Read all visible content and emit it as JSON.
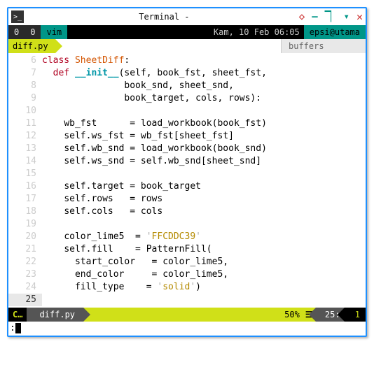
{
  "window": {
    "title": "Terminal -"
  },
  "top_status": {
    "left0": "0",
    "left1": "0",
    "app": "vim",
    "date": "Kam, 10 Feb 06:05",
    "user": "epsi@utama"
  },
  "tabs": {
    "active": "diff.py",
    "right": "buffers"
  },
  "code": {
    "lines": [
      {
        "n": 6,
        "indent": "",
        "tokens": [
          {
            "t": "class ",
            "c": "kw"
          },
          {
            "t": "SheetDiff",
            "c": "cls"
          },
          {
            "t": ":",
            "c": ""
          }
        ]
      },
      {
        "n": 7,
        "indent": "  ",
        "tokens": [
          {
            "t": "def ",
            "c": "kw"
          },
          {
            "t": "__init__",
            "c": "def"
          },
          {
            "t": "(self, book_fst, sheet_fst,",
            "c": ""
          }
        ]
      },
      {
        "n": 8,
        "indent": "               ",
        "tokens": [
          {
            "t": "book_snd, sheet_snd,",
            "c": ""
          }
        ]
      },
      {
        "n": 9,
        "indent": "               ",
        "tokens": [
          {
            "t": "book_target, cols, rows):",
            "c": ""
          }
        ]
      },
      {
        "n": 10,
        "indent": "",
        "tokens": []
      },
      {
        "n": 11,
        "indent": "    ",
        "tokens": [
          {
            "t": "wb_fst      = load_workbook(book_fst)",
            "c": ""
          }
        ]
      },
      {
        "n": 12,
        "indent": "    ",
        "tokens": [
          {
            "t": "self.ws_fst = wb_fst[sheet_fst]",
            "c": ""
          }
        ]
      },
      {
        "n": 13,
        "indent": "    ",
        "tokens": [
          {
            "t": "self.wb_snd = load_workbook(book_snd)",
            "c": ""
          }
        ]
      },
      {
        "n": 14,
        "indent": "    ",
        "tokens": [
          {
            "t": "self.ws_snd = self.wb_snd[sheet_snd]",
            "c": ""
          }
        ]
      },
      {
        "n": 15,
        "indent": "",
        "tokens": []
      },
      {
        "n": 16,
        "indent": "    ",
        "tokens": [
          {
            "t": "self.target = book_target",
            "c": ""
          }
        ]
      },
      {
        "n": 17,
        "indent": "    ",
        "tokens": [
          {
            "t": "self.rows   = rows",
            "c": ""
          }
        ]
      },
      {
        "n": 18,
        "indent": "    ",
        "tokens": [
          {
            "t": "self.cols   = cols",
            "c": ""
          }
        ]
      },
      {
        "n": 19,
        "indent": "",
        "tokens": []
      },
      {
        "n": 20,
        "indent": "    ",
        "tokens": [
          {
            "t": "color_lime5  = ",
            "c": ""
          },
          {
            "t": "'",
            "c": "sep"
          },
          {
            "t": "FFCDDC39",
            "c": "str"
          },
          {
            "t": "'",
            "c": "sep"
          }
        ]
      },
      {
        "n": 21,
        "indent": "    ",
        "tokens": [
          {
            "t": "self.fill    = PatternFill(",
            "c": ""
          }
        ]
      },
      {
        "n": 22,
        "indent": "      ",
        "tokens": [
          {
            "t": "start_color   = color_lime5,",
            "c": ""
          }
        ]
      },
      {
        "n": 23,
        "indent": "      ",
        "tokens": [
          {
            "t": "end_color     = color_lime5,",
            "c": ""
          }
        ]
      },
      {
        "n": 24,
        "indent": "      ",
        "tokens": [
          {
            "t": "fill_type    = ",
            "c": ""
          },
          {
            "t": "'",
            "c": "sep"
          },
          {
            "t": "solid",
            "c": "str"
          },
          {
            "t": "'",
            "c": "sep"
          },
          {
            "t": ")",
            "c": ""
          }
        ]
      },
      {
        "n": 25,
        "indent": "",
        "tokens": [],
        "current": true
      }
    ]
  },
  "bottom_status": {
    "mode": "C…",
    "file": "diff.py",
    "percent": "50%",
    "hamburger": "☰",
    "line": "25:",
    "col": "1"
  },
  "cmdline": ":"
}
